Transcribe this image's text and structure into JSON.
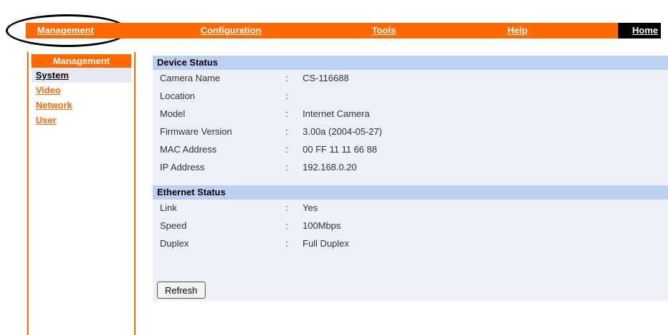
{
  "topnav": {
    "items": [
      {
        "label": "Management"
      },
      {
        "label": "Configuration"
      },
      {
        "label": "Tools"
      },
      {
        "label": "Help"
      }
    ],
    "home_label": "Home"
  },
  "sidebar": {
    "title": "Management",
    "items": [
      {
        "label": "System",
        "active": true
      },
      {
        "label": "Video"
      },
      {
        "label": "Network"
      },
      {
        "label": "User"
      }
    ]
  },
  "device_status": {
    "title": "Device Status",
    "rows": [
      {
        "label": "Camera Name",
        "value": "CS-116688"
      },
      {
        "label": "Location",
        "value": ""
      },
      {
        "label": "Model",
        "value": "Internet Camera"
      },
      {
        "label": "Firmware Version",
        "value": "3.00a (2004-05-27)"
      },
      {
        "label": "MAC Address",
        "value": "00 FF 11 11 66 88"
      },
      {
        "label": "IP Address",
        "value": "192.168.0.20"
      }
    ]
  },
  "ethernet_status": {
    "title": "Ethernet Status",
    "rows": [
      {
        "label": "Link",
        "value": "Yes"
      },
      {
        "label": "Speed",
        "value": "100Mbps"
      },
      {
        "label": "Duplex",
        "value": "Full Duplex"
      }
    ]
  },
  "separator": ":",
  "refresh_label": "Refresh",
  "colors": {
    "accent": "#ff6a00",
    "section_header": "#bcd0f2",
    "panel_bg": "#eef0f8"
  }
}
